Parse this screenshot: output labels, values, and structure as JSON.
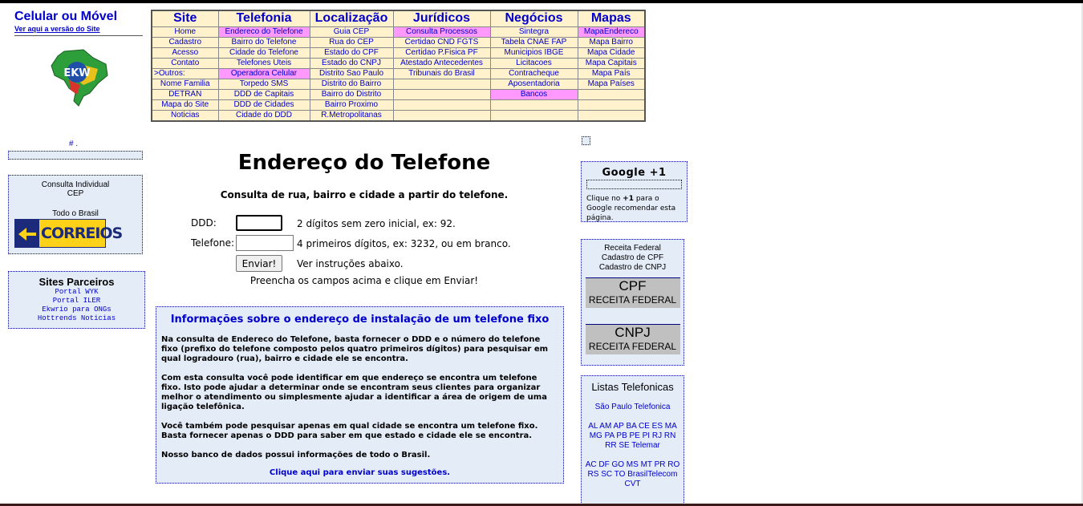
{
  "brand": {
    "title": "Celular ou Móvel",
    "subtitle": "Ver aqui a versão do Site",
    "logo_text": "EKW"
  },
  "menu": {
    "headers": [
      "Site",
      "Telefonia",
      "Localização",
      "Jurídicos",
      "Negócios",
      "Mapas"
    ],
    "rows": [
      [
        "Home",
        "Endereco do Telefone",
        "Guia CEP",
        "Consulta Processos",
        "Sintegra",
        "MapaEndereco"
      ],
      [
        "Cadastro",
        "Bairro do Telefone",
        "Rua do CEP",
        "Certidao CND FGTS",
        "Tabela CNAE FAP",
        "Mapa Bairro"
      ],
      [
        "Acesso",
        "Cidade do Telefone",
        "Estado do CPF",
        "Certidao P.Fisica PF",
        "Municipios IBGE",
        "Mapa Cidade"
      ],
      [
        "Contato",
        "Telefones Uteis",
        "Estado do CNPJ",
        "Atestado Antecedentes",
        "Licitacoes",
        "Mapa Capitais"
      ],
      [
        ">Outros:",
        "Operadora Celular",
        "Distrito Sao Paulo",
        "Tribunais do Brasil",
        "Contracheque",
        "Mapa País"
      ],
      [
        "Nome Familia",
        "Torpedo SMS",
        "Distrito do Bairro",
        "",
        "Aposentadoria",
        "Mapa Países"
      ],
      [
        "DETRAN",
        "DDD de Capitais",
        "Bairro do Distrito",
        "",
        "Bancos",
        ""
      ],
      [
        "Mapa do Site",
        "DDD de Cidades",
        "Bairro Proximo",
        "",
        "",
        ""
      ],
      [
        "Noticias",
        "Cidade do DDD",
        "R.Metropolitanas",
        "",
        "",
        ""
      ]
    ]
  },
  "left": {
    "hash_text": "# .",
    "cep_box": {
      "line1": "Consulta Individual",
      "line2": "CEP",
      "line3": "Todo o Brasil",
      "logo_text": "CORREIOS"
    },
    "partners": {
      "title": "Sites Parceiros",
      "links": [
        "Portal WYK",
        "Portal ILER",
        "Ekwrio para ONGs",
        "Hottrends Noticias"
      ]
    }
  },
  "form": {
    "title": "Endereço do Telefone",
    "subtitle": "Consulta de rua, bairro e cidade a partir do telefone.",
    "ddd_label": "DDD:",
    "ddd_value": "",
    "ddd_hint": "2 dígitos sem zero inicial, ex: 92.",
    "phone_label": "Telefone:",
    "phone_value": "",
    "phone_hint": "4 primeiros dígitos, ex: 3232, ou em branco.",
    "submit_label": "Enviar!",
    "submit_hint": "Ver instruções abaixo.",
    "note": "Preencha os campos acima e clique em Enviar!"
  },
  "info": {
    "title": "Informações sobre o endereço de instalação de um telefone fixo",
    "paragraphs": [
      "Na consulta de Endereco do Telefone, basta fornecer o DDD e o número do telefone fixo (prefixo do telefone composto pelos quatro primeiros dígitos) para pesquisar em qual logradouro (rua), bairro e cidade ele se encontra.",
      "Com esta consulta você pode identificar em que endereço se encontra um telefone fixo. Isto pode ajudar a determinar onde se encontram seus clientes para organizar melhor o atendimento ou simplesmente ajudar a identificar a área de origem de uma ligação telefônica.",
      "Você também pode pesquisar apenas em qual cidade se encontra um telefone fixo. Basta fornecer apenas o DDD para saber em que estado e cidade ele se encontra.",
      "Nosso banco de dados possui informações de todo o Brasil."
    ],
    "suggestion_link": "Clique aqui para enviar suas sugestões."
  },
  "right": {
    "google": {
      "title": "Google +1",
      "text_before": "Clique no ",
      "text_bold": "+1",
      "text_after": " para o Google recomendar esta página."
    },
    "receita": {
      "line1": "Receita Federal",
      "line2": "Cadastro de CPF",
      "line3": "Cadastro de CNPJ",
      "cpf_big": "CPF",
      "cpf_small": "RECEITA FEDERAL",
      "cnpj_big": "CNPJ",
      "cnpj_small": "RECEITA FEDERAL"
    },
    "listas": {
      "title": "Listas Telefonicas",
      "block1": "São Paulo Telefonica",
      "block2": "AL AM AP BA CE ES MA MG PA PB PE PI RJ RN RR SE Telemar",
      "block3": "AC DF GO MS MT PR RO RS SC TO BrasilTelecom CVT"
    }
  },
  "colors": {
    "link": "#0000cc",
    "menu_bg": "#fff2cc",
    "highlight": "#ff99ff",
    "box_bg": "#e4ecf8",
    "correios_yellow": "#ffd21a",
    "correios_blue": "#1b2a7a"
  }
}
